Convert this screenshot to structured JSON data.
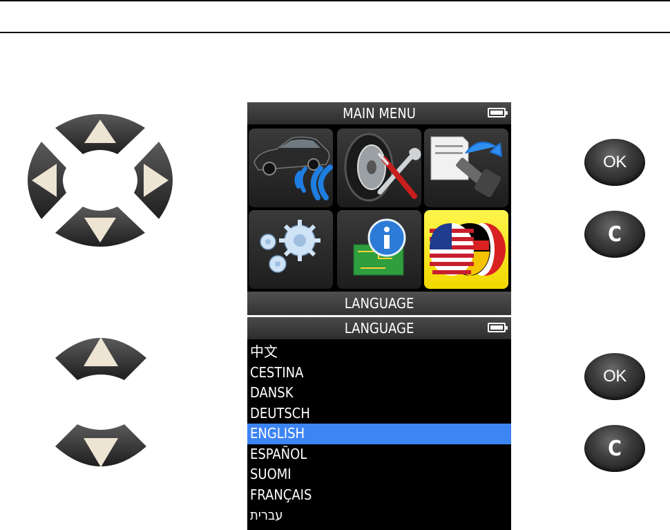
{
  "main_menu": {
    "title": "MAIN MENU",
    "tiles": [
      {
        "icon": "car-signal-icon"
      },
      {
        "icon": "tire-tools-icon"
      },
      {
        "icon": "sensor-download-icon"
      },
      {
        "icon": "settings-gears-icon"
      },
      {
        "icon": "info-board-icon"
      },
      {
        "icon": "language-flags-icon",
        "selected": true
      }
    ],
    "selected_label": "LANGUAGE"
  },
  "language_menu": {
    "title": "LANGUAGE",
    "items": [
      "中文",
      "CESTINA",
      "DANSK",
      "DEUTSCH",
      "ENGLISH",
      "ESPAÑOL",
      "SUOMI",
      "FRANÇAIS",
      "עברית"
    ],
    "selected_index": 4
  },
  "buttons": {
    "ok_label": "OK",
    "c_label": "C"
  },
  "colors": {
    "highlight": "#3d84f5",
    "selected_tile": "#f5e21a",
    "button_dark": "#2b2b2b",
    "arrow_fill": "#ede4d3"
  }
}
